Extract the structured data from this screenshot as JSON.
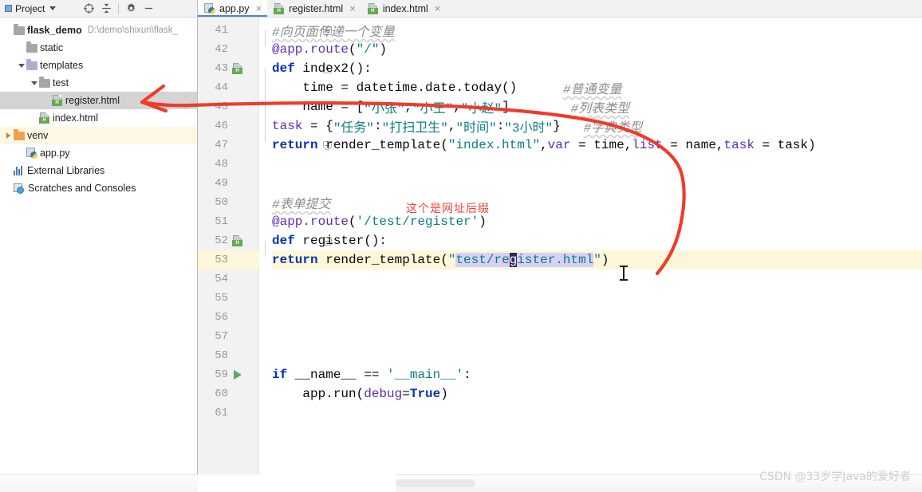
{
  "project_panel": {
    "title": "Project",
    "toolbar_icons": [
      {
        "name": "locate-icon",
        "glyph": "locate"
      },
      {
        "name": "collapse-all-icon",
        "glyph": "collapse"
      },
      {
        "name": "settings-gear-icon",
        "glyph": "gear"
      },
      {
        "name": "minimize-icon",
        "glyph": "minus"
      }
    ],
    "tree": [
      {
        "label": "flask_demo",
        "path": "D:\\demo\\shixun\\flask_",
        "icon": "folder",
        "indent": 0,
        "twist": "none",
        "bold": true,
        "state": "normal"
      },
      {
        "label": "static",
        "path": "",
        "icon": "folder",
        "indent": 1,
        "twist": "none",
        "bold": false,
        "state": "normal"
      },
      {
        "label": "templates",
        "path": "",
        "icon": "folder-purple",
        "indent": 1,
        "twist": "open",
        "bold": false,
        "state": "normal"
      },
      {
        "label": "test",
        "path": "",
        "icon": "folder",
        "indent": 2,
        "twist": "open",
        "bold": false,
        "state": "normal"
      },
      {
        "label": "register.html",
        "path": "",
        "icon": "html",
        "indent": 3,
        "twist": "none",
        "bold": false,
        "state": "selected"
      },
      {
        "label": "index.html",
        "path": "",
        "icon": "html",
        "indent": 2,
        "twist": "none",
        "bold": false,
        "state": "normal"
      },
      {
        "label": "venv",
        "path": "",
        "icon": "folder-orange",
        "indent": 0,
        "twist": "closed",
        "bold": false,
        "state": "highlight"
      },
      {
        "label": "app.py",
        "path": "",
        "icon": "py",
        "indent": 1,
        "twist": "none",
        "bold": false,
        "state": "normal"
      },
      {
        "label": "External Libraries",
        "path": "",
        "icon": "lib",
        "indent": 0,
        "twist": "none",
        "bold": false,
        "state": "normal"
      },
      {
        "label": "Scratches and Consoles",
        "path": "",
        "icon": "scratch",
        "indent": 0,
        "twist": "none",
        "bold": false,
        "state": "normal"
      }
    ]
  },
  "editor_tabs": [
    {
      "label": "app.py",
      "icon": "py",
      "active": true,
      "close": "×"
    },
    {
      "label": "register.html",
      "icon": "html",
      "active": false,
      "close": "×"
    },
    {
      "label": "index.html",
      "icon": "html",
      "active": false,
      "close": "×"
    }
  ],
  "code": {
    "first_line_number": 41,
    "current_line": 53,
    "lines": [
      {
        "n": 41,
        "gutter_icon": "none",
        "fold": "minus",
        "text": "#向页面传递一个变量"
      },
      {
        "n": 42,
        "gutter_icon": "none",
        "fold": "none",
        "text": "@app.route(\"/\")"
      },
      {
        "n": 43,
        "gutter_icon": "html",
        "fold": "minus",
        "text": "def index2():"
      },
      {
        "n": 44,
        "gutter_icon": "none",
        "fold": "none",
        "text": "    time = datetime.date.today()      #普通变量"
      },
      {
        "n": 45,
        "gutter_icon": "none",
        "fold": "none",
        "text": "    name = [\"小张\",\"小王\",\"小赵\"]        #列表类型"
      },
      {
        "n": 46,
        "gutter_icon": "none",
        "fold": "none",
        "text": "    task = {\"任务\":\"打扫卫生\",\"时间\":\"3小时\"}   #字典类型"
      },
      {
        "n": 47,
        "gutter_icon": "none",
        "fold": "end",
        "text": "    return render_template(\"index.html\",var = time,list = name,task = task)"
      },
      {
        "n": 48,
        "gutter_icon": "none",
        "fold": "none",
        "text": ""
      },
      {
        "n": 49,
        "gutter_icon": "none",
        "fold": "none",
        "text": ""
      },
      {
        "n": 50,
        "gutter_icon": "none",
        "fold": "none",
        "text": "#表单提交"
      },
      {
        "n": 51,
        "gutter_icon": "none",
        "fold": "none",
        "text": "@app.route('/test/register')"
      },
      {
        "n": 52,
        "gutter_icon": "html",
        "fold": "minus",
        "text": "def register():"
      },
      {
        "n": 53,
        "gutter_icon": "none",
        "fold": "end",
        "text": "    return render_template(\"test/register.html\")"
      },
      {
        "n": 54,
        "gutter_icon": "none",
        "fold": "none",
        "text": ""
      },
      {
        "n": 55,
        "gutter_icon": "none",
        "fold": "none",
        "text": ""
      },
      {
        "n": 56,
        "gutter_icon": "none",
        "fold": "none",
        "text": ""
      },
      {
        "n": 57,
        "gutter_icon": "none",
        "fold": "none",
        "text": ""
      },
      {
        "n": 58,
        "gutter_icon": "none",
        "fold": "none",
        "text": ""
      },
      {
        "n": 59,
        "gutter_icon": "run",
        "fold": "none",
        "text": "if __name__ == '__main__':"
      },
      {
        "n": 60,
        "gutter_icon": "none",
        "fold": "none",
        "text": "    app.run(debug=True)"
      },
      {
        "n": 61,
        "gutter_icon": "none",
        "fold": "none",
        "text": ""
      }
    ],
    "selection_text": "test/register.html",
    "caret_char": "g"
  },
  "annotations": {
    "red_note": "这个是网址后缀",
    "red_color": "#f0443e",
    "arrow_name": "red-annotation-arrow"
  },
  "watermark": "CSDN @33岁学Java的爱好者",
  "colors": {
    "keyword": "#0033b3",
    "string": "#067d17",
    "string_cyan": "#0a7d87",
    "decorator": "#5b2bb5",
    "comment": "#8c8c8c",
    "current_line_bg": "#fdf6d8",
    "selection_bg": "#d6d1f5",
    "tree_selected_bg": "#d4d4d4",
    "tree_highlight_bg": "#fcf8e3"
  }
}
